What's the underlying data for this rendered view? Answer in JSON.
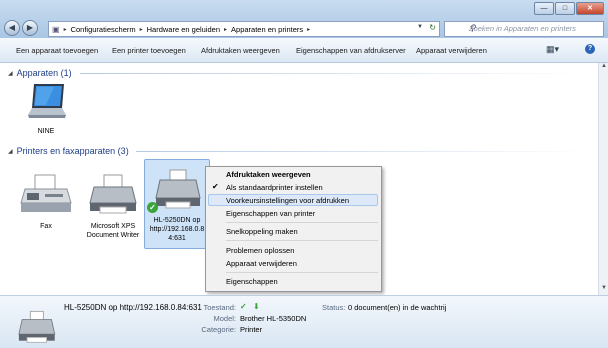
{
  "window": {
    "minimize": "—",
    "maximize": "□",
    "close": "✕"
  },
  "address": {
    "segments": [
      "Configuratiescherm",
      "Hardware en geluiden",
      "Apparaten en printers"
    ],
    "sep": "▸"
  },
  "search": {
    "placeholder": "Zoeken in Apparaten en printers"
  },
  "toolbar": {
    "items": [
      "Een apparaat toevoegen",
      "Een printer toevoegen",
      "Afdruktaken weergeven",
      "Eigenschappen van afdrukserver",
      "Apparaat verwijderen"
    ]
  },
  "groups": {
    "devices": "Apparaten (1)",
    "printers": "Printers en faxapparaten (3)"
  },
  "devices": [
    {
      "label": "NINE"
    }
  ],
  "printers": [
    {
      "label": "Fax"
    },
    {
      "label1": "Microsoft XPS",
      "label2": "Document Writer"
    },
    {
      "label1": "HL-5250DN op",
      "label2": "http://192.168.0.8",
      "label3": "4:631"
    }
  ],
  "context_menu": {
    "items": [
      "Afdruktaken weergeven",
      "Als standaardprinter instellen",
      "Voorkeursinstellingen voor afdrukken",
      "Eigenschappen van printer",
      "Snelkoppeling maken",
      "Problemen oplossen",
      "Apparaat verwijderen",
      "Eigenschappen"
    ]
  },
  "details": {
    "name": "HL-5250DN op http://192.168.0.84:631",
    "state_label": "Toestand:",
    "model_label": "Model:",
    "model": "Brother HL-5350DN",
    "category_label": "Categorie:",
    "category": "Printer",
    "status_label": "Status:",
    "status": "0 document(en) in de wachtrij"
  }
}
